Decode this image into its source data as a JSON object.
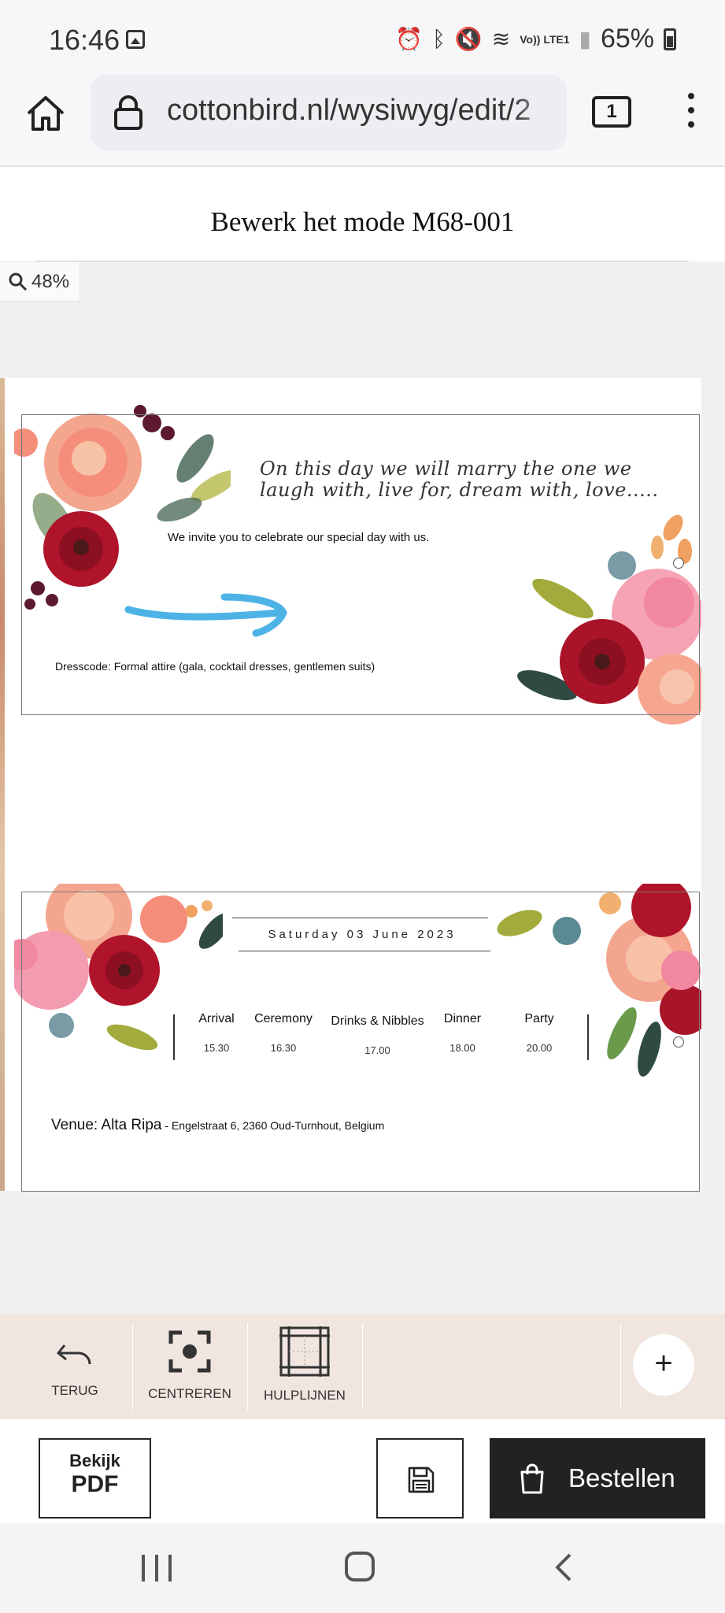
{
  "status_bar": {
    "time": "16:46",
    "lte": "Vo)) LTE1",
    "battery": "65%"
  },
  "browser": {
    "url": "cottonbird.nl/wysiwyg/edit/2",
    "tab_count": "1"
  },
  "editor": {
    "title": "Bewerk het mode M68-001",
    "zoom": "48%"
  },
  "card_front": {
    "script_text": "On this day we will marry the one we laugh with, live for, dream with, love.....",
    "invite_text": "We invite you to celebrate our special day with us.",
    "dresscode": "Dresscode: Formal attire (gala, cocktail dresses, gentlemen suits)"
  },
  "card_back": {
    "date": "Saturday  03 June 2023",
    "schedule": [
      {
        "label": "Arrival",
        "time": "15.30"
      },
      {
        "label": "Ceremony",
        "time": "16.30"
      },
      {
        "label": "Drinks & Nibbles",
        "time": "17.00"
      },
      {
        "label": "Dinner",
        "time": "18.00"
      },
      {
        "label": "Party",
        "time": "20.00"
      }
    ],
    "venue_name": "Venue: Alta Ripa",
    "venue_address": " - Engelstraat 6, 2360 Oud-Turnhout, Belgium"
  },
  "toolbar": {
    "undo_label": "TERUG",
    "center_label": "CENTREREN",
    "guides_label": "HULPLIJNEN",
    "add_label": "+"
  },
  "actions": {
    "pdf_line1": "Bekijk",
    "pdf_line2": "PDF",
    "order_label": "Bestellen"
  },
  "colors": {
    "arrow": "#4db3e6",
    "toolbar_bg": "#f1e6df",
    "order_bg": "#222222"
  }
}
